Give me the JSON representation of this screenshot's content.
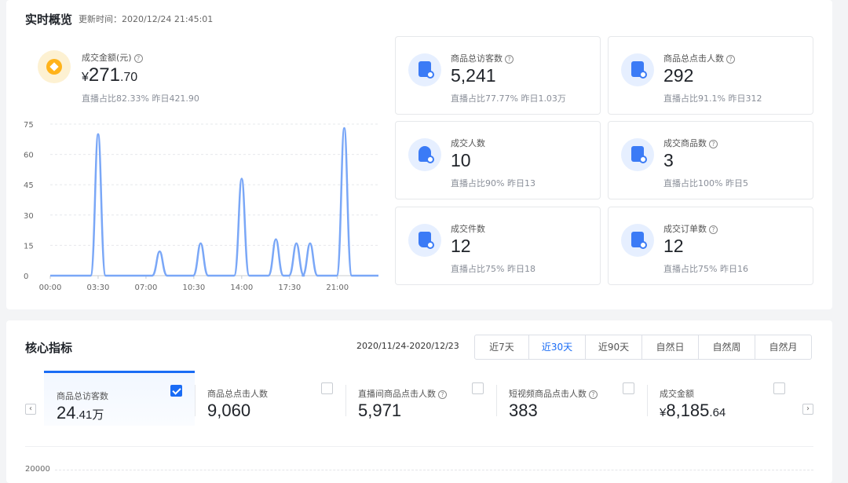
{
  "realtime": {
    "title": "实时概览",
    "updated_prefix": "更新时间：",
    "updated_time": "2020/12/24 21:45:01",
    "amount": {
      "label": "成交金额(元)",
      "currency": "¥",
      "value_int": "271",
      "value_dec": ".70",
      "sub": "直播占比82.33%  昨日421.90"
    },
    "cards": [
      {
        "label": "商品总访客数",
        "value": "5,241",
        "sub": "直播占比77.77%  昨日1.03万",
        "icon": "visitor-icon"
      },
      {
        "label": "商品总点击人数",
        "value": "292",
        "sub": "直播占比91.1%  昨日312",
        "icon": "click-user-icon"
      },
      {
        "label": "成交人数",
        "value": "10",
        "sub": "直播占比90%  昨日13",
        "icon": "buyer-icon"
      },
      {
        "label": "成交商品数",
        "value": "3",
        "sub": "直播占比100%  昨日5",
        "icon": "product-icon"
      },
      {
        "label": "成交件数",
        "value": "12",
        "sub": "直播占比75%  昨日18",
        "icon": "bag-icon"
      },
      {
        "label": "成交订单数",
        "value": "12",
        "sub": "直播占比75%  昨日16",
        "icon": "order-icon"
      }
    ]
  },
  "chart_data": {
    "type": "line",
    "x_ticks": [
      "00:00",
      "03:30",
      "07:00",
      "10:30",
      "14:00",
      "17:30",
      "21:00"
    ],
    "ylim": [
      0,
      75
    ],
    "y_ticks": [
      0,
      15,
      30,
      45,
      60,
      75
    ],
    "grid": true,
    "color": "#7aa7f7",
    "series": [
      {
        "x_hours": [
          3.5,
          8.0,
          11.0,
          14.0,
          16.5,
          18.0,
          19.0,
          21.5
        ],
        "values": [
          70,
          12,
          16,
          48,
          18,
          16,
          16,
          73
        ]
      }
    ]
  },
  "core": {
    "title": "核心指标",
    "date_range": "2020/11/24-2020/12/23",
    "tabs": [
      "近7天",
      "近30天",
      "近90天",
      "自然日",
      "自然周",
      "自然月"
    ],
    "active_tab": 1,
    "metrics": [
      {
        "label": "商品总访客数",
        "value": "24",
        "dec": ".41",
        "unit": "万",
        "checked": true,
        "help": false
      },
      {
        "label": "商品总点击人数",
        "value": "9,060",
        "checked": false,
        "help": false
      },
      {
        "label": "直播间商品点击人数",
        "value": "5,971",
        "checked": false,
        "help": true
      },
      {
        "label": "短视频商品点击人数",
        "value": "383",
        "checked": false,
        "help": true
      },
      {
        "label": "成交金额",
        "prefix": "¥",
        "value": "8,185",
        "dec": ".64",
        "checked": false,
        "help": false
      }
    ],
    "chart_top_tick": "20000"
  }
}
